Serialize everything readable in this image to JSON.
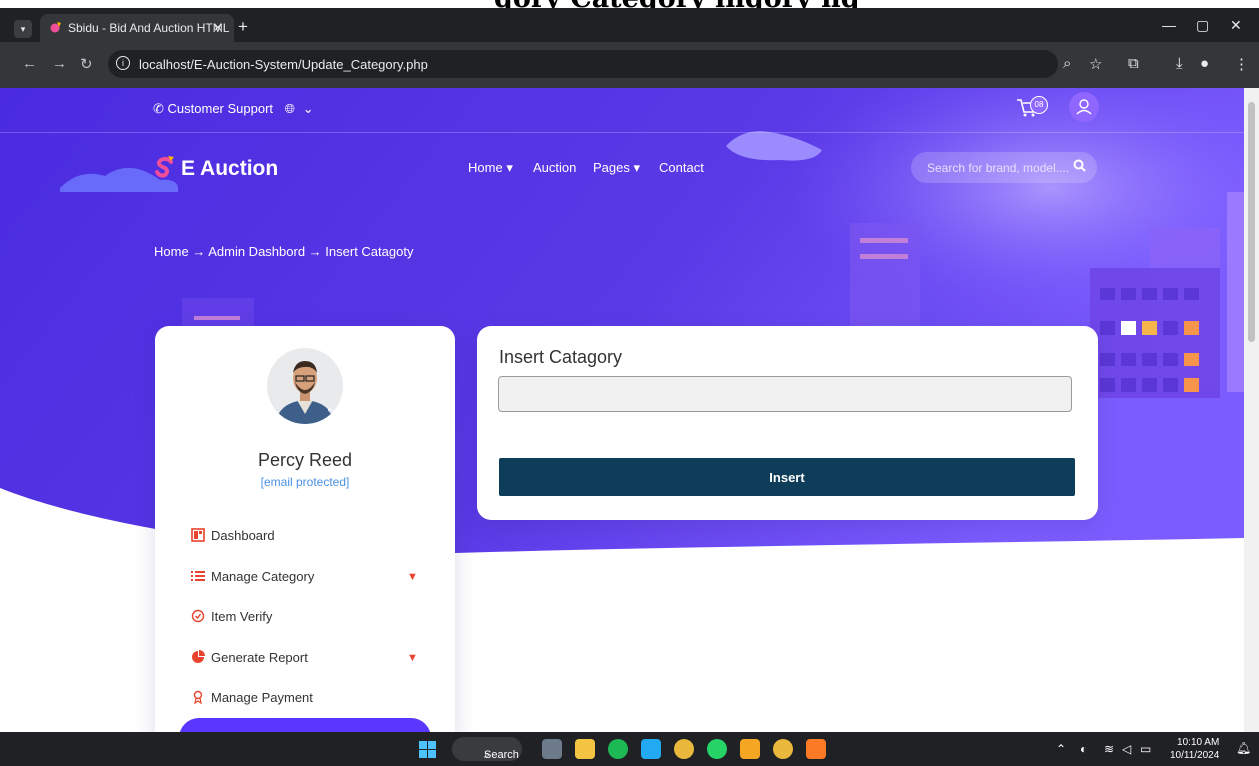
{
  "browser": {
    "tab_title": "Sbidu - Bid And Auction HTML",
    "url": "localhost/E-Auction-System/Update_Category.php"
  },
  "topbar": {
    "support_label": "Customer Support",
    "cart_count": "08"
  },
  "brand": {
    "name": "E Auction"
  },
  "nav": {
    "home": "Home",
    "auction": "Auction",
    "pages": "Pages",
    "contact": "Contact"
  },
  "search": {
    "placeholder": "Search for brand, model...."
  },
  "breadcrumb": {
    "home": "Home",
    "admin": "Admin Dashbord",
    "current": "Insert Catagoty"
  },
  "profile": {
    "name": "Percy Reed",
    "email": "[email protected]"
  },
  "sidebar": {
    "items": [
      {
        "label": "Dashboard"
      },
      {
        "label": "Manage Category"
      },
      {
        "label": "Item Verify"
      },
      {
        "label": "Generate Report"
      },
      {
        "label": "Manage Payment"
      }
    ]
  },
  "form": {
    "title": "Insert Catagory",
    "input_value": "",
    "submit_label": "Insert"
  },
  "taskbar": {
    "search_label": "Search",
    "time": "10:10 AM",
    "date": "10/11/2024"
  },
  "colors": {
    "hero_start": "#4a2be0",
    "hero_end": "#7b5cff",
    "button": "#0e3d5a",
    "link": "#4a90e2",
    "arrow": "#e8432d"
  }
}
